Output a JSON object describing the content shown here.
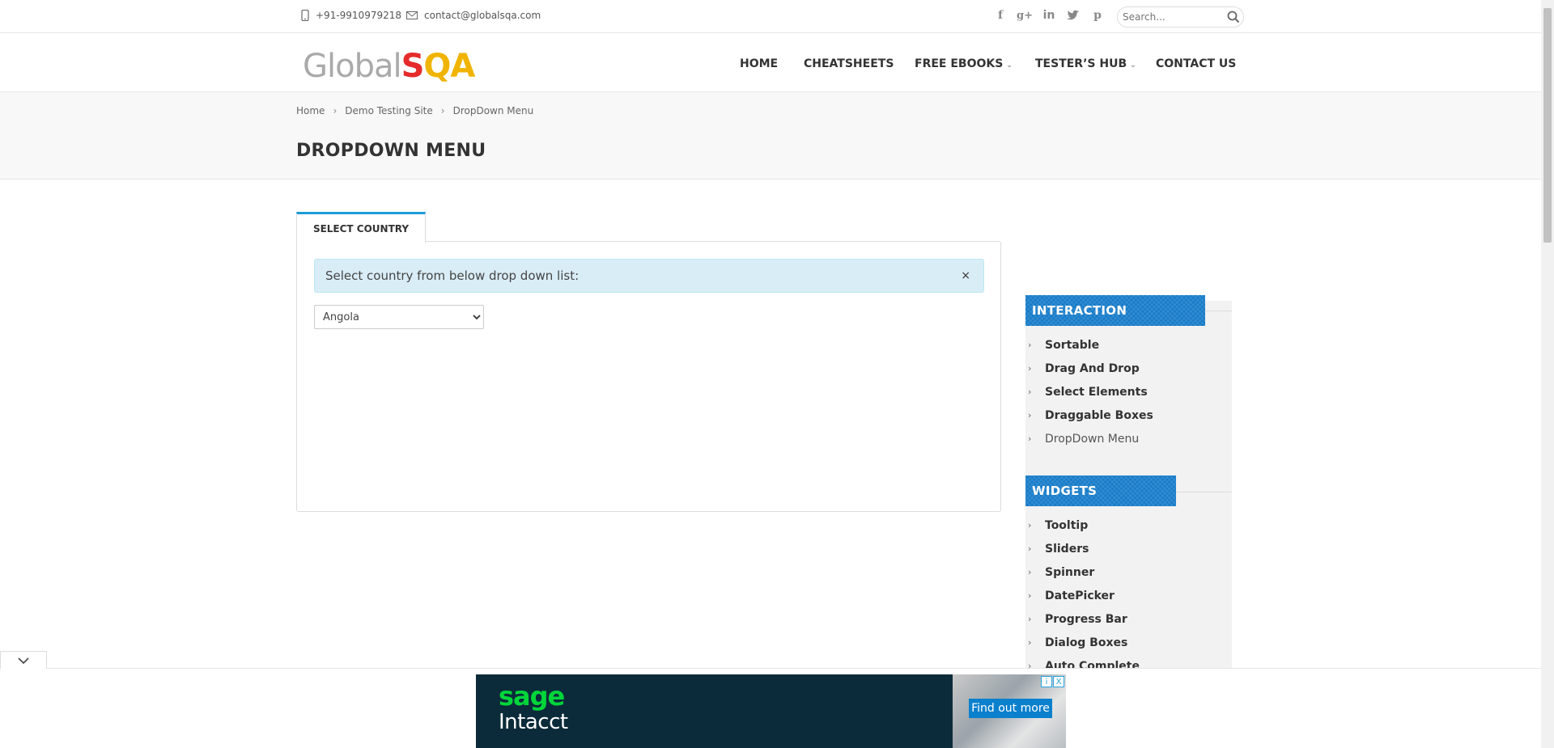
{
  "topbar": {
    "phone": "+91-9910979218",
    "email": "contact@globalsqa.com",
    "social": [
      "facebook-icon",
      "google-plus-icon",
      "linkedin-icon",
      "twitter-icon",
      "pinterest-icon"
    ],
    "search_placeholder": "Search..."
  },
  "logo": {
    "part1": "Global",
    "part2": "S",
    "part3": "QA"
  },
  "nav": {
    "home": "HOME",
    "cheatsheets": "CHEATSHEETS",
    "free_ebooks": "FREE EBOOKS",
    "testers_hub": "TESTER’S HUB",
    "contact_us": "CONTACT US"
  },
  "breadcrumb": {
    "home": "Home",
    "demo": "Demo Testing Site",
    "current": "DropDown Menu",
    "sep": "›"
  },
  "page_title": "DROPDOWN MENU",
  "tab_label": "SELECT COUNTRY",
  "alert_text": "Select country from below drop down list:",
  "alert_close": "×",
  "country_select": {
    "selected": "Angola"
  },
  "sidebar": {
    "interaction_title": "INTERACTION",
    "interaction_items": [
      "Sortable",
      "Drag And Drop",
      "Select Elements",
      "Draggable Boxes",
      "DropDown Menu"
    ],
    "widgets_title": "WIDGETS",
    "widgets_items": [
      "Tooltip",
      "Sliders",
      "Spinner",
      "DatePicker",
      "Progress Bar",
      "Dialog Boxes",
      "Auto Complete"
    ]
  },
  "ad": {
    "brand": "sage",
    "product": "Intacct",
    "cta": "Find out more",
    "info": "i",
    "close": "X"
  },
  "colors": {
    "accent": "#1e9bd7",
    "widget_blue": "#1379c8",
    "alert_bg": "#d9edf7",
    "ad_bg": "#0c2b3a",
    "sage_green": "#00d639"
  }
}
